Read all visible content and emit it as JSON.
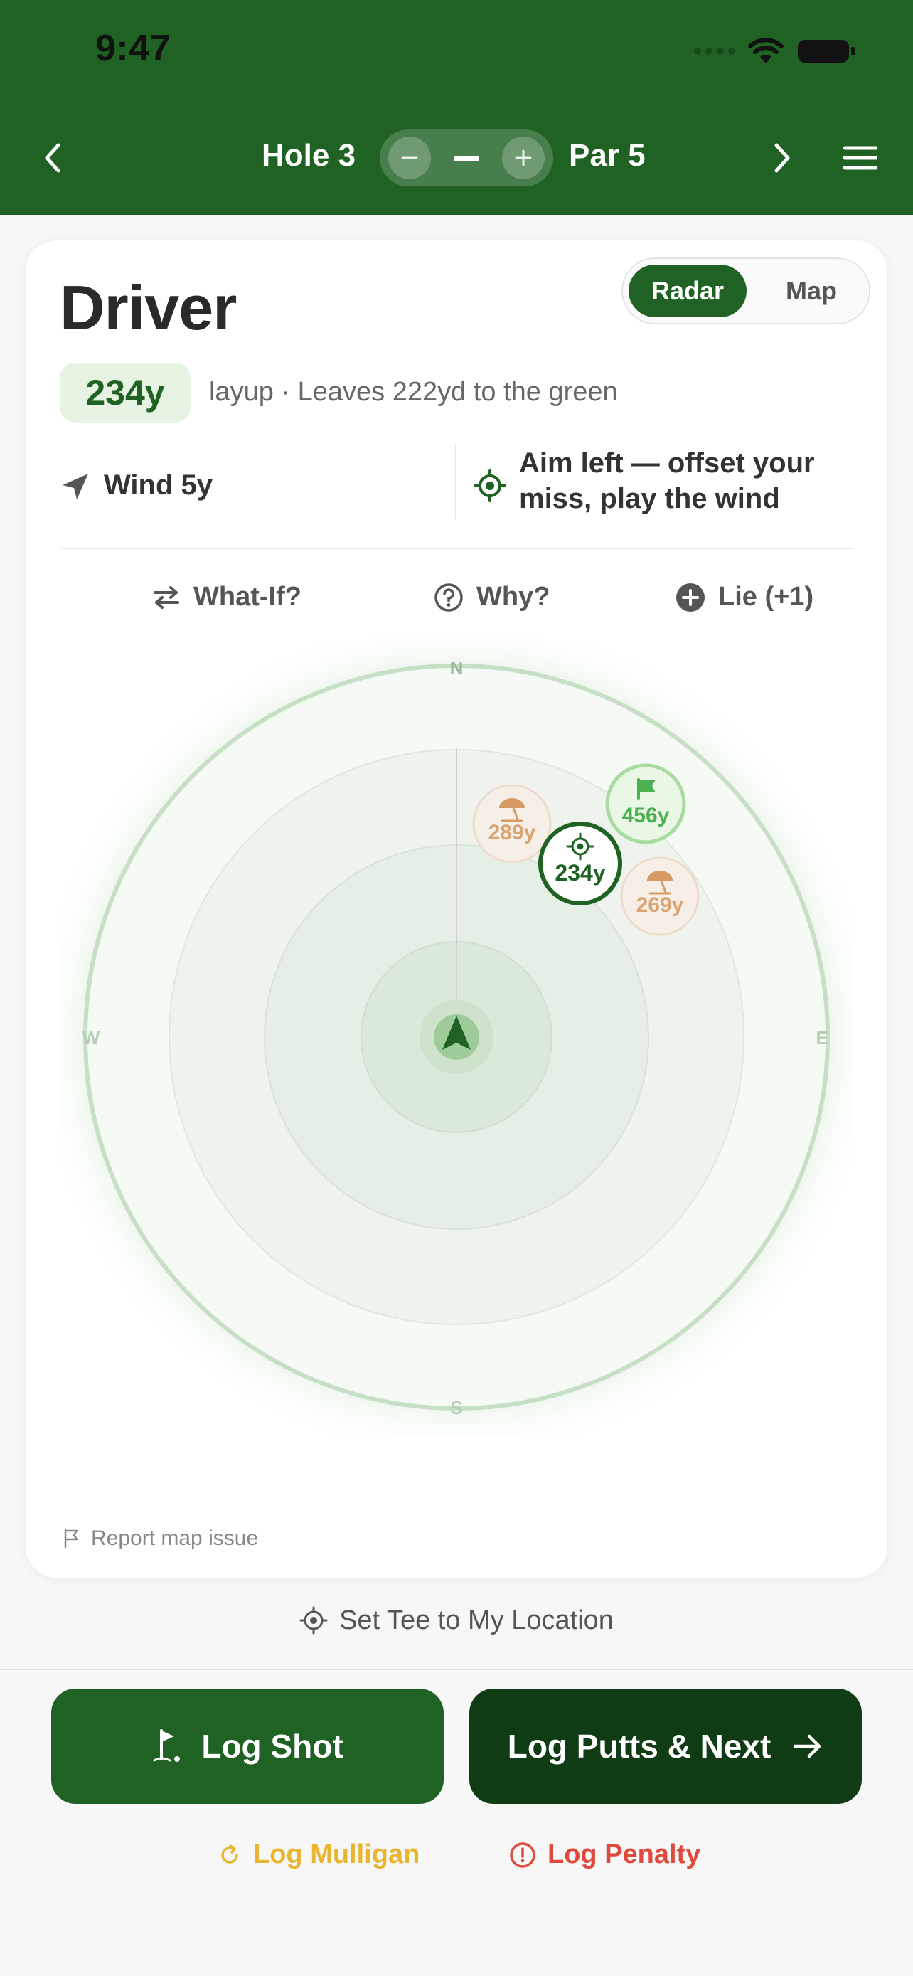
{
  "status_bar": {
    "time": "9:47"
  },
  "header": {
    "hole_label": "Hole 3",
    "par_label": "Par 5",
    "colors": {
      "background": "#1f6224"
    }
  },
  "shot_card": {
    "club": "Driver",
    "view_toggle": {
      "options": [
        "Radar",
        "Map"
      ],
      "selected": "Radar"
    },
    "distance_badge": "234y",
    "description": "layup · Leaves 222yd to the green",
    "wind": "Wind 5y",
    "aim_advice": "Aim left — offset your miss, play the wind",
    "actions": {
      "what_if": "What-If?",
      "why": "Why?",
      "lie": "Lie (+1)"
    },
    "report_link": "Report map issue"
  },
  "radar": {
    "compass": {
      "n": "N",
      "e": "E",
      "s": "S",
      "w": "W"
    },
    "markers": {
      "hazard_1": "289y",
      "pin": "456y",
      "target": "234y",
      "hazard_2": "269y"
    },
    "icons": [
      "bunker-icon",
      "flag-icon",
      "crosshair-icon",
      "player-arrow-icon"
    ]
  },
  "set_tee": "Set Tee to My Location",
  "bottom_actions": {
    "log_shot": "Log Shot",
    "log_putts": "Log Putts & Next",
    "mulligan": "Log Mulligan",
    "penalty": "Log Penalty",
    "colors": {
      "primary": "#1f6224",
      "dark": "#0f3c14",
      "mulligan": "#e9b52f",
      "penalty": "#e04a3c"
    }
  }
}
